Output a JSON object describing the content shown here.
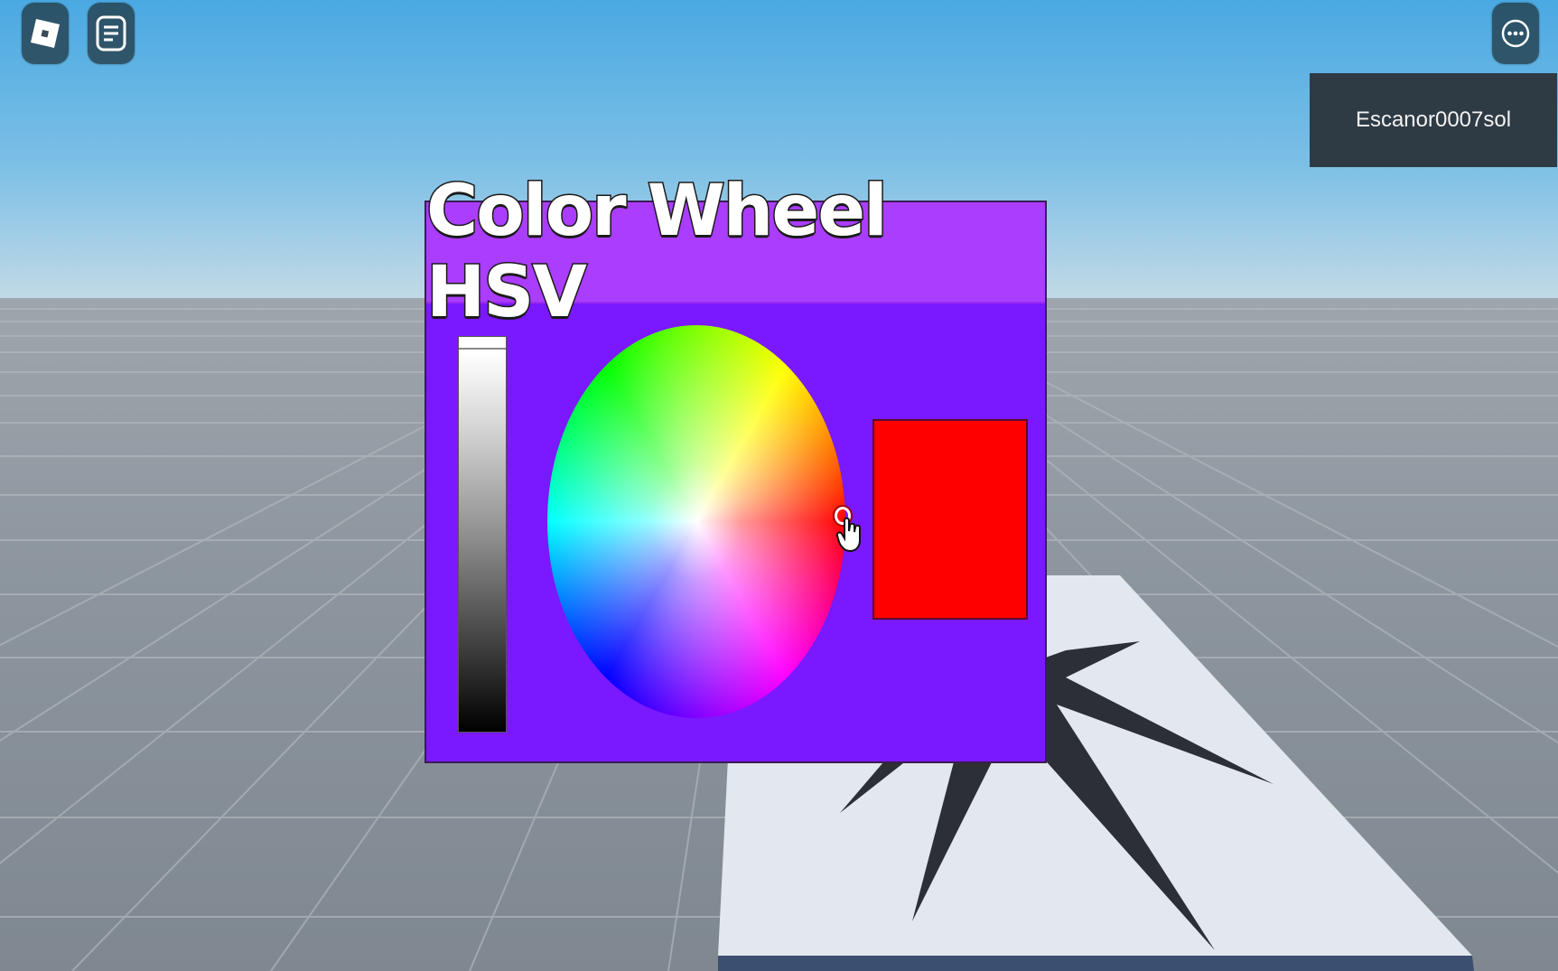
{
  "world": {
    "sky_color": "#5aa7dd",
    "ground_color": "#8d969e"
  },
  "topbar": {
    "roblox_icon": "roblox-logo-icon",
    "chat_icon": "chat-icon",
    "more_icon": "more-options-icon"
  },
  "player_list": {
    "username": "Escanor0007sol"
  },
  "color_wheel_gui": {
    "title": "Color Wheel HSV",
    "header_color": "#ab3dff",
    "panel_color": "#7a18ff",
    "selected_color": "#ff0000",
    "value_level": 1.0,
    "selected_hue_deg": 0,
    "selected_saturation": 1.0
  }
}
